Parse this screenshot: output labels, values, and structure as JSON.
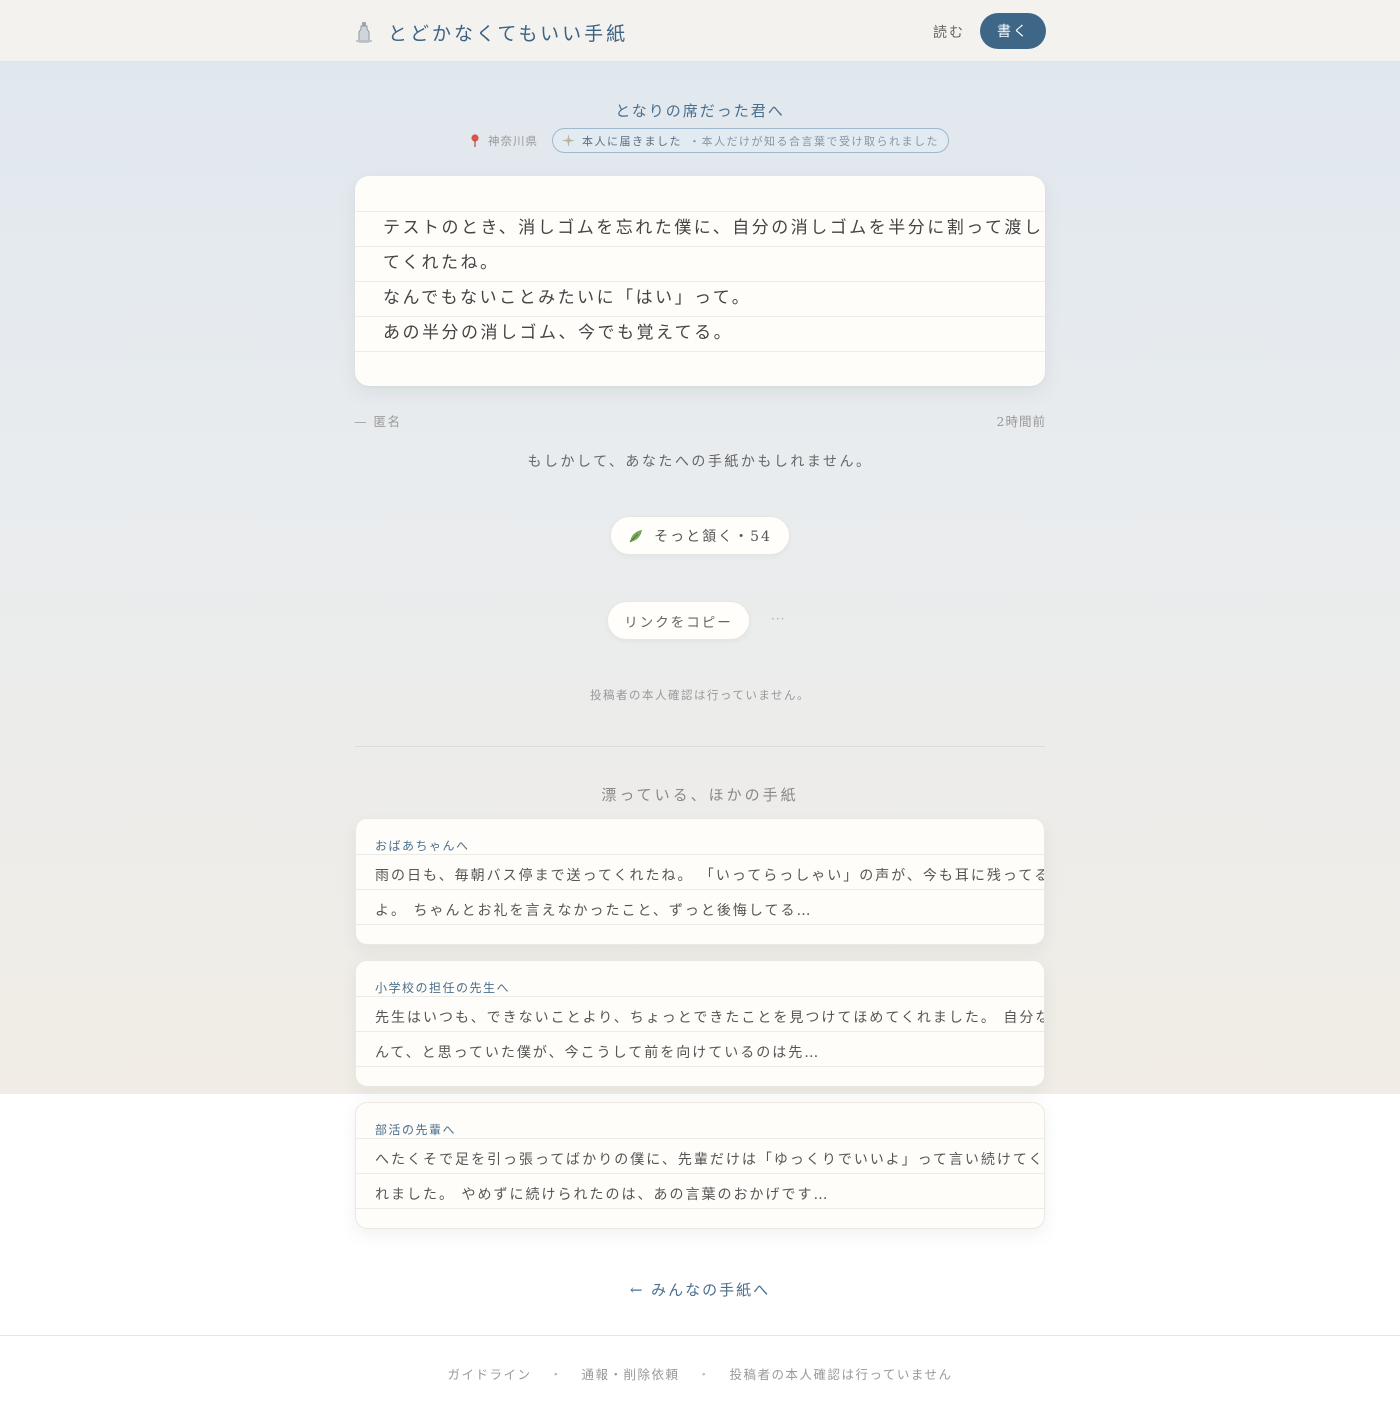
{
  "header": {
    "title": "とどかなくてもいい手紙",
    "read_label": "読む",
    "write_label": "書く"
  },
  "letter": {
    "to": "となりの席だった君へ",
    "location": "神奈川県",
    "delivered_label": "本人に届きました",
    "delivered_sub": "・本人だけが知る合言葉で受け取られました",
    "lines": [
      "テストのとき、消しゴムを忘れた僕に、自分の消しゴムを半分に割って渡し",
      "てくれたね。",
      "なんでもないことみたいに「はい」って。",
      "あの半分の消しゴム、今でも覚えてる。"
    ],
    "signature": "— 匿名",
    "time": "2時間前"
  },
  "maybe_text": "もしかして、あなたへの手紙かもしれません。",
  "nod_button": "そっと頷く・54",
  "copy_link_button": "リンクをコピー",
  "more_label": "···",
  "identity_note": "投稿者の本人確認は行っていません。",
  "other_section_title": "漂っている、ほかの手紙",
  "other_letters": [
    {
      "to": "おばあちゃんへ",
      "lines": [
        "雨の日も、毎朝バス停まで送ってくれたね。 「いってらっしゃい」の声が、今も耳に残ってる",
        "よ。 ちゃんとお礼を言えなかったこと、ずっと後悔してる…"
      ]
    },
    {
      "to": "小学校の担任の先生へ",
      "lines": [
        "先生はいつも、できないことより、ちょっとできたことを見つけてほめてくれました。 自分な",
        "んて、と思っていた僕が、今こうして前を向けているのは先…"
      ]
    },
    {
      "to": "部活の先輩へ",
      "lines": [
        "へたくそで足を引っ張ってばかりの僕に、先輩だけは「ゆっくりでいいよ」って言い続けてく",
        "れました。 やめずに続けられたのは、あの言葉のおかげです…"
      ]
    }
  ],
  "back_link": "← みんなの手紙へ",
  "footer": {
    "guideline": "ガイドライン",
    "report": "通報・削除依頼",
    "disclaimer": "投稿者の本人確認は行っていません",
    "separator": "・"
  },
  "colors": {
    "accent": "#3e6787",
    "link": "#4b6f8e"
  }
}
